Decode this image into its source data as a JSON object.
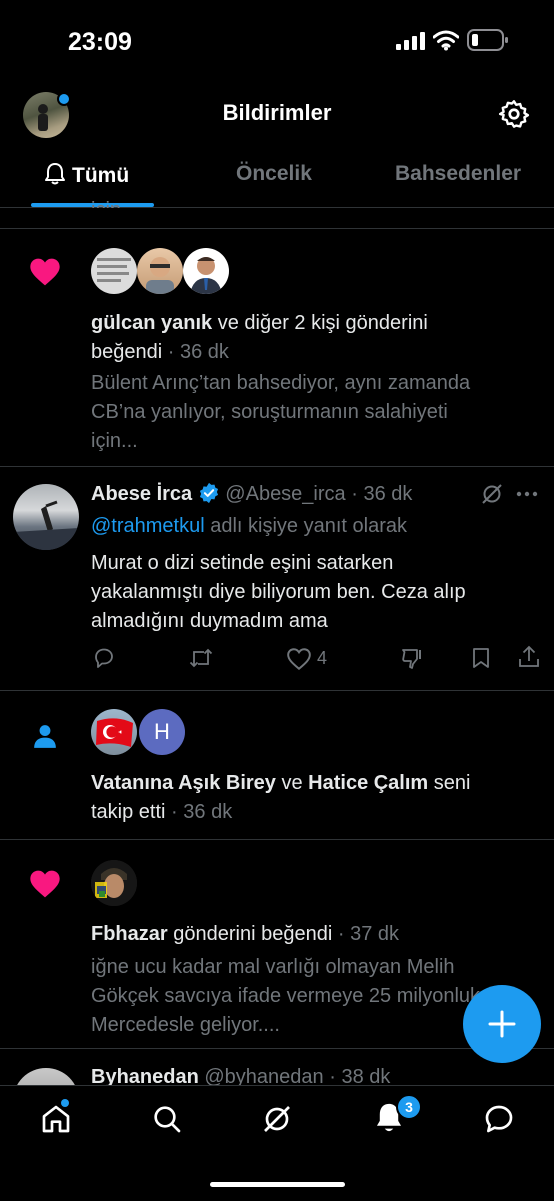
{
  "status": {
    "time": "23:09"
  },
  "header": {
    "title": "Bildirimler"
  },
  "tabs": [
    {
      "label": "Tümü"
    },
    {
      "label": "Öncelik"
    },
    {
      "label": "Bahsedenler"
    }
  ],
  "partial_top_text": "için...",
  "notifications": [
    {
      "type": "like",
      "actor": "gülcan yanık",
      "action": "ve diğer 2 kişi gönderini",
      "action2": "beğendi",
      "time": "36 dk",
      "preview_lines": [
        "Bülent Arınç’tan bahsediyor, aynı zamanda",
        "CB’na yanlıyor, soruşturmanın salahiyeti",
        "için..."
      ]
    },
    {
      "type": "reply",
      "name": "Abese İrca",
      "handle": "@Abese_irca",
      "time": "36 dk",
      "reply_to_user": "@trahmetkul",
      "reply_to_suffix": "adlı kişiye yanıt olarak",
      "text_lines": [
        "Murat o dizi setinde eşini satarken",
        "yakalanmıştı diye biliyorum ben. Ceza alıp",
        "almadığını duymadım ama"
      ],
      "like_count": "4"
    },
    {
      "type": "follow",
      "actor1": "Vatanına Aşık Birey",
      "conj": "ve",
      "actor2": "Hatice Çalım",
      "action": "seni",
      "action2": "takip etti",
      "time": "36 dk",
      "avatar_letter": "H"
    },
    {
      "type": "like",
      "actor": "Fbhazar",
      "action": "gönderini beğendi",
      "time": "37 dk",
      "preview_lines": [
        "iğne ucu kadar mal varlığı olmayan Melih",
        "Gökçek savcıya ifade vermeye 25 milyonluk",
        "Mercedesle geliyor...."
      ]
    },
    {
      "type": "reply",
      "name": "Byhanedan",
      "handle": "@byhanedan",
      "time": "38 dk"
    }
  ],
  "nav": {
    "notification_badge": "3"
  },
  "colors": {
    "accent": "#1d9bf0",
    "like": "#f91880",
    "background": "#000000",
    "text": "#e7e9ea",
    "muted": "#71767b"
  }
}
